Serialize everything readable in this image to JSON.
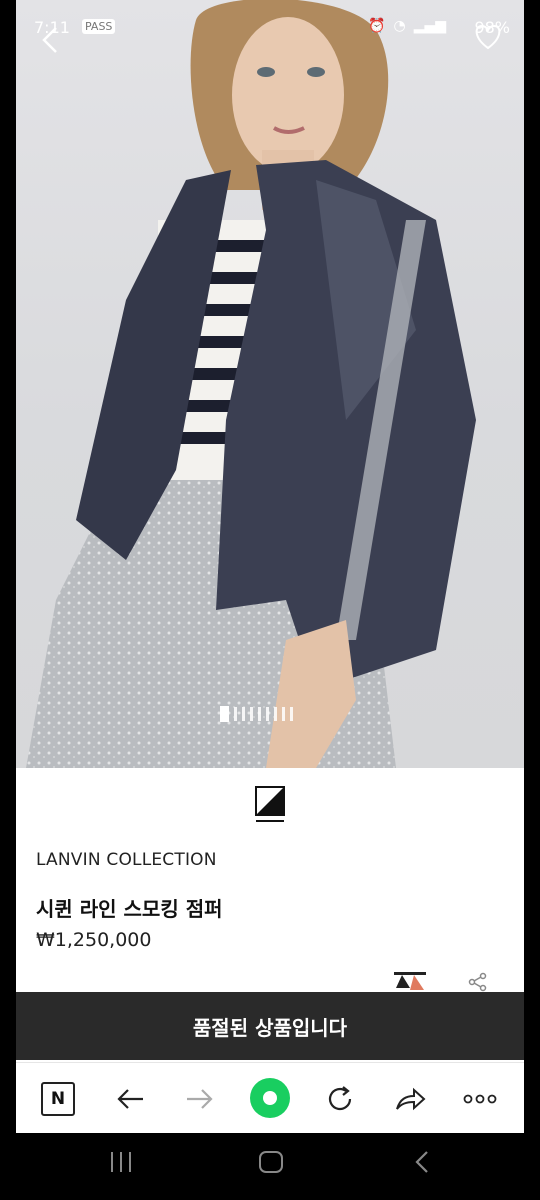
{
  "status_bar": {
    "time": "7:11",
    "icons": [
      "PASS"
    ],
    "battery": "98%"
  },
  "carousel": {
    "total": 9,
    "active_index": 0
  },
  "product": {
    "brand": "LANVIN COLLECTION",
    "name": "시퀸 라인 스모킹 점퍼",
    "price": "₩1,250,000"
  },
  "sold_out_label": "품절된 상품입니다",
  "browser_nav": {
    "icons": [
      "naver-icon",
      "back-arrow-icon",
      "forward-arrow-icon",
      "home-circle-icon",
      "refresh-icon",
      "share-icon",
      "more-icon"
    ],
    "naver_letter": "N"
  },
  "colors": {
    "sold_out_bar": "#2a2a2a",
    "home_green": "#19ce60"
  }
}
